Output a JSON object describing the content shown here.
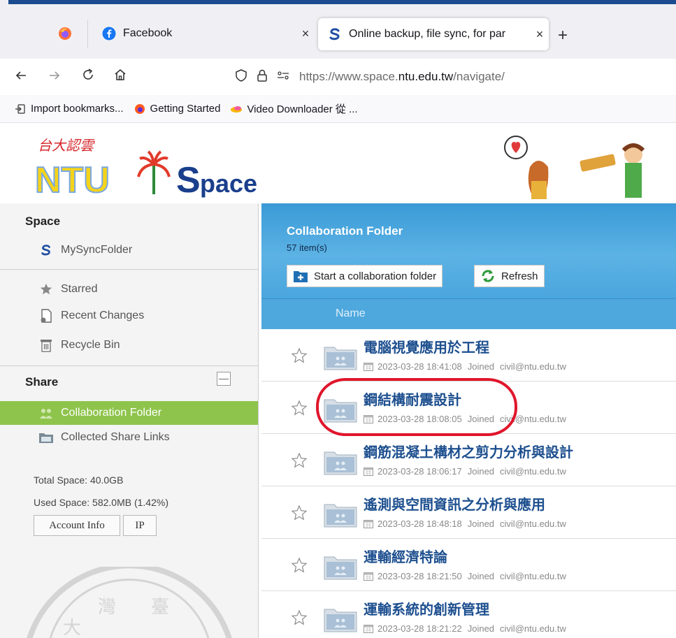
{
  "browser": {
    "tabs": [
      {
        "title": "Facebook",
        "close": "×"
      },
      {
        "title": "Online backup, file sync, for par",
        "close": "×"
      }
    ],
    "new_tab": "+",
    "url": {
      "prefix": "https://www.space.",
      "domain": "ntu.edu.tw",
      "path": "/navigate/"
    },
    "bookmarks": [
      "Import bookmarks...",
      "Getting Started",
      "Video Downloader 從 ..."
    ]
  },
  "header": {
    "logo_caption": "台大認雲",
    "logo_text_ntu": "NTU",
    "logo_text_space": "pace",
    "logo_text_s": "S"
  },
  "sidebar": {
    "space_title": "Space",
    "mysync": "MySyncFolder",
    "items": [
      "Starred",
      "Recent Changes",
      "Recycle Bin"
    ],
    "share_title": "Share",
    "share_collapse": "—",
    "share_items": [
      "Collaboration Folder",
      "Collected Share Links"
    ],
    "total_space": "Total Space: 40.0GB",
    "used_space": "Used Space: 582.0MB (1.42%)",
    "account_info": "Account Info",
    "ip": "IP"
  },
  "main": {
    "title": "Collaboration Folder",
    "count": "57 item(s)",
    "start_button": "Start a collaboration folder",
    "refresh_button": "Refresh",
    "col_name": "Name",
    "rows": [
      {
        "name": "電腦視覺應用於工程",
        "date": "2023-03-28 18:41:08",
        "status": "Joined",
        "email": "civil@ntu.edu.tw"
      },
      {
        "name": "鋼結構耐震設計",
        "date": "2023-03-28 18:08:05",
        "status": "Joined",
        "email": "civil@ntu.edu.tw"
      },
      {
        "name": "鋼筋混凝土構材之剪力分析與設計",
        "date": "2023-03-28 18:06:17",
        "status": "Joined",
        "email": "civil@ntu.edu.tw"
      },
      {
        "name": "遙測與空間資訊之分析與應用",
        "date": "2023-03-28 18:48:18",
        "status": "Joined",
        "email": "civil@ntu.edu.tw"
      },
      {
        "name": "運輸經濟特論",
        "date": "2023-03-28 18:21:50",
        "status": "Joined",
        "email": "civil@ntu.edu.tw"
      },
      {
        "name": "運輸系統的創新管理",
        "date": "2023-03-28 18:21:22",
        "status": "Joined",
        "email": "civil@ntu.edu.tw"
      }
    ]
  },
  "colors": {
    "accent_green": "#8ec44c",
    "header_blue": "#4fa8dd",
    "folder_name": "#1d4f8f",
    "annotation_red": "#e0162c"
  }
}
